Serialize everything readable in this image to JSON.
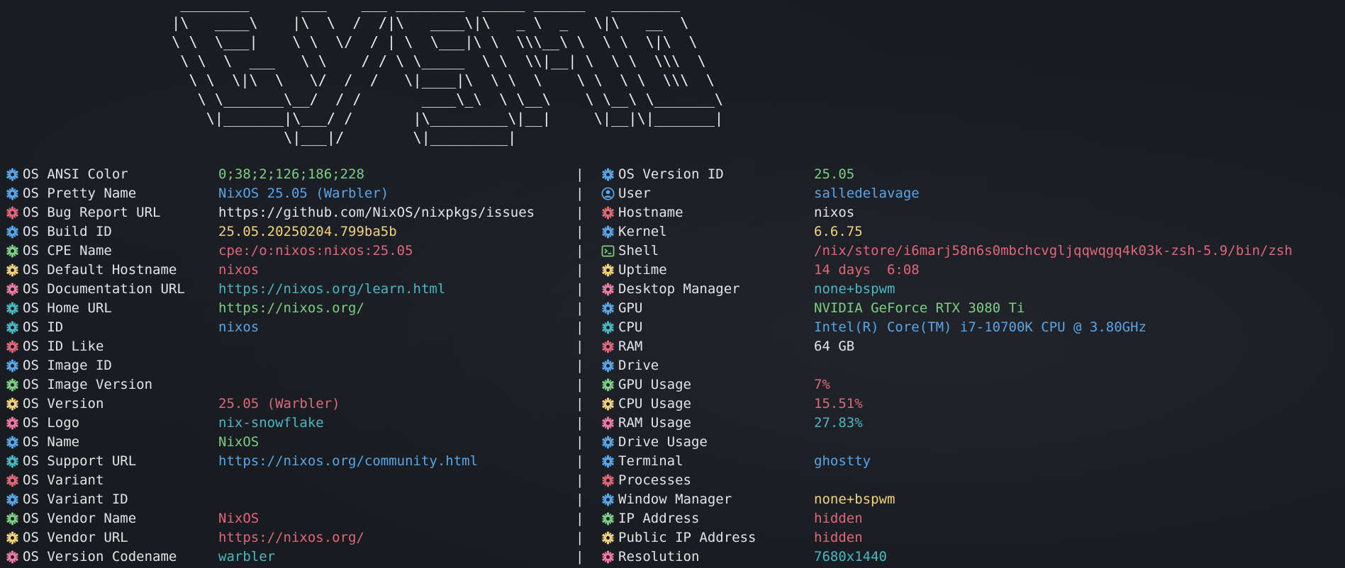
{
  "ascii_logo": [
    "  ________      ___    ___ ________  _____ ______   ________",
    " |\\   ____\\    |\\  \\  /  /|\\   ____\\|\\   _ \\  _   \\|\\   __  \\",
    " \\ \\  \\___|    \\ \\  \\/  / | \\  \\___|\\ \\  \\\\\\__\\ \\  \\ \\  \\|\\  \\",
    "  \\ \\  \\  ___   \\ \\    / / \\ \\_____  \\ \\  \\\\|__| \\  \\ \\  \\\\\\  \\",
    "   \\ \\  \\|\\  \\   \\/  /  /   \\|____|\\  \\ \\  \\    \\ \\  \\ \\  \\\\\\  \\",
    "    \\ \\_______\\__/  / /       ____\\_\\  \\ \\__\\    \\ \\__\\ \\_______\\",
    "     \\|_______|\\___/ /       |\\_________\\|__|     \\|__|\\|_______|",
    "              \\|___|/        \\|_________|"
  ],
  "separator": "|",
  "colors": {
    "blue": "#58a6e8",
    "green": "#7ccf84",
    "red": "#e0677a",
    "yellow": "#f2d27d",
    "cyan": "#4ab8c4",
    "pink": "#ef7ba4",
    "white": "#e2e4e7"
  },
  "left_rows": [
    {
      "icon": "gear-icon",
      "icon_color": "blue",
      "label": "OS ANSI Color",
      "value": "0;38;2;126;186;228",
      "value_color": "green"
    },
    {
      "icon": "gear-icon",
      "icon_color": "blue",
      "label": "OS Pretty Name",
      "value": "NixOS 25.05 (Warbler)",
      "value_color": "blue"
    },
    {
      "icon": "gear-icon",
      "icon_color": "red",
      "label": "OS Bug Report URL",
      "value": "https://github.com/NixOS/nixpkgs/issues",
      "value_color": "white"
    },
    {
      "icon": "gear-icon",
      "icon_color": "blue",
      "label": "OS Build ID",
      "value": "25.05.20250204.799ba5b",
      "value_color": "yellow"
    },
    {
      "icon": "gear-icon",
      "icon_color": "green",
      "label": "OS CPE Name",
      "value": "cpe:/o:nixos:nixos:25.05",
      "value_color": "red"
    },
    {
      "icon": "gear-icon",
      "icon_color": "yellow",
      "label": "OS Default Hostname",
      "value": "nixos",
      "value_color": "red"
    },
    {
      "icon": "gear-icon",
      "icon_color": "pink",
      "label": "OS Documentation URL",
      "value": "https://nixos.org/learn.html",
      "value_color": "cyan"
    },
    {
      "icon": "gear-icon",
      "icon_color": "cyan",
      "label": "OS Home URL",
      "value": "https://nixos.org/",
      "value_color": "green"
    },
    {
      "icon": "gear-icon",
      "icon_color": "cyan",
      "label": "OS ID",
      "value": "nixos",
      "value_color": "blue"
    },
    {
      "icon": "gear-icon",
      "icon_color": "red",
      "label": "OS ID Like",
      "value": "",
      "value_color": "white"
    },
    {
      "icon": "gear-icon",
      "icon_color": "blue",
      "label": "OS Image ID",
      "value": "",
      "value_color": "white"
    },
    {
      "icon": "gear-icon",
      "icon_color": "green",
      "label": "OS Image Version",
      "value": "",
      "value_color": "white"
    },
    {
      "icon": "gear-icon",
      "icon_color": "yellow",
      "label": "OS Version",
      "value": "25.05 (Warbler)",
      "value_color": "red"
    },
    {
      "icon": "gear-icon",
      "icon_color": "pink",
      "label": "OS Logo",
      "value": "nix-snowflake",
      "value_color": "cyan"
    },
    {
      "icon": "gear-icon",
      "icon_color": "blue",
      "label": "OS Name",
      "value": "NixOS",
      "value_color": "green"
    },
    {
      "icon": "gear-icon",
      "icon_color": "cyan",
      "label": "OS Support URL",
      "value": "https://nixos.org/community.html",
      "value_color": "blue"
    },
    {
      "icon": "gear-icon",
      "icon_color": "red",
      "label": "OS Variant",
      "value": "",
      "value_color": "white"
    },
    {
      "icon": "gear-icon",
      "icon_color": "blue",
      "label": "OS Variant ID",
      "value": "",
      "value_color": "white"
    },
    {
      "icon": "gear-icon",
      "icon_color": "green",
      "label": "OS Vendor Name",
      "value": "NixOS",
      "value_color": "red"
    },
    {
      "icon": "gear-icon",
      "icon_color": "yellow",
      "label": "OS Vendor URL",
      "value": "https://nixos.org/",
      "value_color": "red"
    },
    {
      "icon": "gear-icon",
      "icon_color": "pink",
      "label": "OS Version Codename",
      "value": "warbler",
      "value_color": "cyan"
    }
  ],
  "right_rows": [
    {
      "icon": "gear-icon",
      "icon_color": "blue",
      "label": "OS Version ID",
      "value": "25.05",
      "value_color": "green"
    },
    {
      "icon": "user-icon",
      "icon_color": "blue",
      "label": "User",
      "value": "salledelavage",
      "value_color": "blue"
    },
    {
      "icon": "gear-icon",
      "icon_color": "red",
      "label": "Hostname",
      "value": "nixos",
      "value_color": "white"
    },
    {
      "icon": "gear-icon",
      "icon_color": "blue",
      "label": "Kernel",
      "value": "6.6.75",
      "value_color": "yellow"
    },
    {
      "icon": "terminal-icon",
      "icon_color": "green",
      "label": "Shell",
      "value": "/nix/store/i6marj58n6s0mbchcvgljqqwqgq4k03k-zsh-5.9/bin/zsh",
      "value_color": "red"
    },
    {
      "icon": "gear-icon",
      "icon_color": "yellow",
      "label": "Uptime",
      "value": "14 days  6:08",
      "value_color": "red"
    },
    {
      "icon": "gear-icon",
      "icon_color": "pink",
      "label": "Desktop Manager",
      "value": "none+bspwm",
      "value_color": "cyan"
    },
    {
      "icon": "gear-icon",
      "icon_color": "blue",
      "label": "GPU",
      "value": "NVIDIA GeForce RTX 3080 Ti",
      "value_color": "green"
    },
    {
      "icon": "gear-icon",
      "icon_color": "cyan",
      "label": "CPU",
      "value": "Intel(R) Core(TM) i7-10700K CPU @ 3.80GHz",
      "value_color": "blue"
    },
    {
      "icon": "gear-icon",
      "icon_color": "red",
      "label": "RAM",
      "value": "64 GB",
      "value_color": "white"
    },
    {
      "icon": "gear-icon",
      "icon_color": "blue",
      "label": "Drive",
      "value": "",
      "value_color": "white"
    },
    {
      "icon": "gear-icon",
      "icon_color": "green",
      "label": "GPU Usage",
      "value": "7%",
      "value_color": "red"
    },
    {
      "icon": "gear-icon",
      "icon_color": "yellow",
      "label": "CPU Usage",
      "value": "15.51%",
      "value_color": "red"
    },
    {
      "icon": "gear-icon",
      "icon_color": "pink",
      "label": "RAM Usage",
      "value": "27.83%",
      "value_color": "cyan"
    },
    {
      "icon": "gear-icon",
      "icon_color": "blue",
      "label": "Drive Usage",
      "value": "",
      "value_color": "white"
    },
    {
      "icon": "gear-icon",
      "icon_color": "blue",
      "label": "Terminal",
      "value": "ghostty",
      "value_color": "blue"
    },
    {
      "icon": "gear-icon",
      "icon_color": "red",
      "label": "Processes",
      "value": "",
      "value_color": "white"
    },
    {
      "icon": "gear-icon",
      "icon_color": "blue",
      "label": "Window Manager",
      "value": "none+bspwm",
      "value_color": "yellow"
    },
    {
      "icon": "gear-icon",
      "icon_color": "green",
      "label": "IP Address",
      "value": "hidden",
      "value_color": "red"
    },
    {
      "icon": "gear-icon",
      "icon_color": "yellow",
      "label": "Public IP Address",
      "value": "hidden",
      "value_color": "red"
    },
    {
      "icon": "gear-icon",
      "icon_color": "pink",
      "label": "Resolution",
      "value": "7680x1440",
      "value_color": "cyan"
    }
  ]
}
